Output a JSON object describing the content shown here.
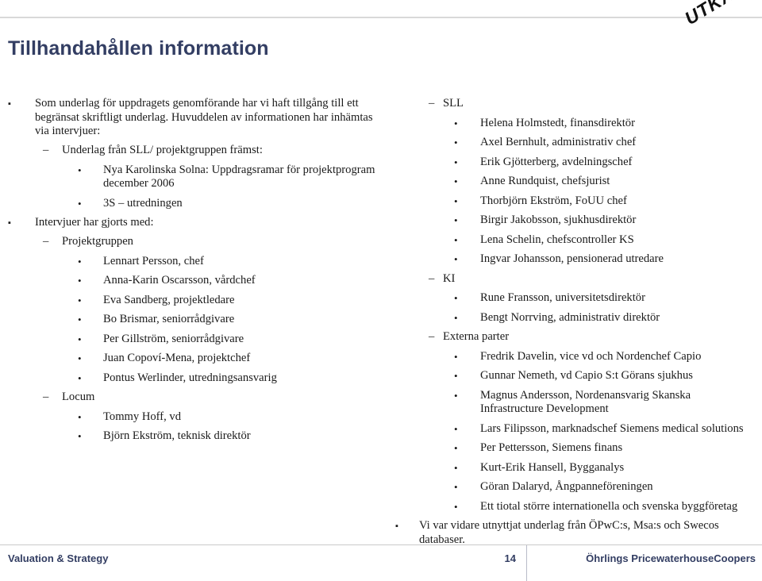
{
  "watermark": {
    "text": "UTKAST"
  },
  "title": "Tillhandahållen information",
  "left_column": [
    {
      "level": 1,
      "marker": "▪",
      "text": "Som underlag för uppdragets genomförande har vi haft tillgång till ett begränsat skriftligt underlag. Huvuddelen av informationen har inhämtas via intervjuer:"
    },
    {
      "level": 2,
      "marker": "–",
      "text": "Underlag från SLL/ projektgruppen främst:"
    },
    {
      "level": 3,
      "marker": "•",
      "text": "Nya Karolinska Solna: Uppdragsramar för projektprogram december 2006"
    },
    {
      "level": 3,
      "marker": "•",
      "text": "3S – utredningen"
    },
    {
      "level": 1,
      "marker": "▪",
      "text": "Intervjuer har gjorts med:"
    },
    {
      "level": 2,
      "marker": "–",
      "text": "Projektgruppen"
    },
    {
      "level": 3,
      "marker": "•",
      "text": "Lennart Persson, chef"
    },
    {
      "level": 3,
      "marker": "•",
      "text": "Anna-Karin Oscarsson, vårdchef"
    },
    {
      "level": 3,
      "marker": "•",
      "text": "Eva Sandberg, projektledare"
    },
    {
      "level": 3,
      "marker": "•",
      "text": "Bo Brismar, seniorrådgivare"
    },
    {
      "level": 3,
      "marker": "•",
      "text": "Per Gillström, seniorrådgivare"
    },
    {
      "level": 3,
      "marker": "•",
      "text": "Juan Copoví-Mena, projektchef"
    },
    {
      "level": 3,
      "marker": "•",
      "text": "Pontus Werlinder, utredningsansvarig"
    },
    {
      "level": 2,
      "marker": "–",
      "text": "Locum"
    },
    {
      "level": 3,
      "marker": "•",
      "text": "Tommy Hoff, vd"
    },
    {
      "level": 3,
      "marker": "•",
      "text": "Björn Ekström, teknisk direktör"
    }
  ],
  "right_column": [
    {
      "level": 2,
      "marker": "–",
      "text": "SLL"
    },
    {
      "level": 3,
      "marker": "•",
      "text": "Helena Holmstedt, finansdirektör"
    },
    {
      "level": 3,
      "marker": "•",
      "text": "Axel Bernhult, administrativ chef"
    },
    {
      "level": 3,
      "marker": "•",
      "text": "Erik Gjötterberg, avdelningschef"
    },
    {
      "level": 3,
      "marker": "•",
      "text": "Anne Rundquist, chefsjurist"
    },
    {
      "level": 3,
      "marker": "•",
      "text": "Thorbjörn Ekström, FoUU chef"
    },
    {
      "level": 3,
      "marker": "•",
      "text": "Birgir Jakobsson, sjukhusdirektör"
    },
    {
      "level": 3,
      "marker": "•",
      "text": "Lena Schelin, chefscontroller KS"
    },
    {
      "level": 3,
      "marker": "•",
      "text": "Ingvar Johansson, pensionerad utredare"
    },
    {
      "level": 2,
      "marker": "–",
      "text": "KI"
    },
    {
      "level": 3,
      "marker": "•",
      "text": "Rune Fransson, universitetsdirektör"
    },
    {
      "level": 3,
      "marker": "•",
      "text": "Bengt Norrving, administrativ direktör"
    },
    {
      "level": 2,
      "marker": "–",
      "text": "Externa parter"
    },
    {
      "level": 3,
      "marker": "•",
      "text": "Fredrik Davelin, vice vd och Nordenchef Capio"
    },
    {
      "level": 3,
      "marker": "•",
      "text": "Gunnar Nemeth, vd Capio S:t Görans sjukhus"
    },
    {
      "level": 3,
      "marker": "•",
      "text": "Magnus Andersson, Nordenansvarig Skanska Infrastructure Development"
    },
    {
      "level": 3,
      "marker": "•",
      "text": "Lars Filipsson, marknadschef Siemens medical solutions"
    },
    {
      "level": 3,
      "marker": "•",
      "text": "Per Pettersson, Siemens finans"
    },
    {
      "level": 3,
      "marker": "•",
      "text": "Kurt-Erik Hansell, Bygganalys"
    },
    {
      "level": 3,
      "marker": "•",
      "text": "Göran Dalaryd, Ångpanneföreningen"
    },
    {
      "level": 3,
      "marker": "•",
      "text": "Ett tiotal större internationella och svenska byggföretag"
    },
    {
      "level": 1,
      "marker": "▪",
      "text": "Vi var vidare utnyttjat underlag från ÖPwC:s, Msa:s och Swecos databaser."
    }
  ],
  "footer": {
    "left": "Valuation & Strategy",
    "page_number": "14",
    "right": "Öhrlings PricewaterhouseCoopers"
  },
  "colors": {
    "title": "#333e63",
    "footer_text": "#333e63",
    "rule": "#d9d9d9",
    "body_text": "#1a1a1a"
  }
}
